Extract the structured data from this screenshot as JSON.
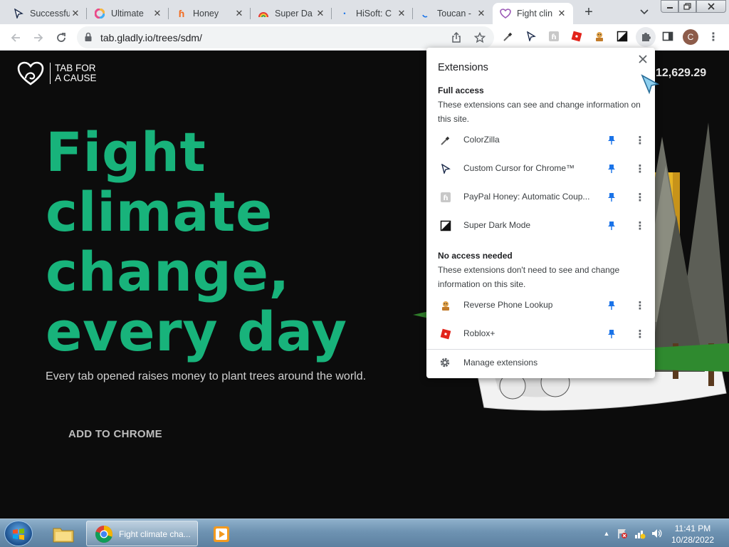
{
  "tabs": [
    {
      "label": "Successfu",
      "icon": "cursor-icon"
    },
    {
      "label": "Ultimate",
      "icon": "colorful-circle-icon"
    },
    {
      "label": "Honey",
      "icon": "honey-icon"
    },
    {
      "label": "Super Da",
      "icon": "rainbow-icon"
    },
    {
      "label": "HiSoft: C",
      "icon": "loading-icon"
    },
    {
      "label": "Toucan -",
      "icon": "loading-icon"
    },
    {
      "label": "Fight clin",
      "icon": "tab-for-a-cause-icon"
    }
  ],
  "address_bar": {
    "url": "tab.gladly.io/trees/sdm/"
  },
  "profile": {
    "initial": "C"
  },
  "page": {
    "logo_line1": "TAB FOR",
    "logo_line2": "A CAUSE",
    "counter": "12,629.29",
    "headline_1": "Fight",
    "headline_2": "climate",
    "headline_3": "change,",
    "headline_4": "every day",
    "subline": "Every tab opened raises money to plant trees around the world.",
    "cta": "ADD TO CHROME"
  },
  "extensions_popup": {
    "title": "Extensions",
    "full_access": {
      "heading": "Full access",
      "description": "These extensions can see and change information on this site.",
      "items": [
        {
          "name": "ColorZilla",
          "icon": "eyedropper-icon"
        },
        {
          "name": "Custom Cursor for Chrome™",
          "icon": "cursor-icon"
        },
        {
          "name": "PayPal Honey: Automatic Coup...",
          "icon": "honey-icon"
        },
        {
          "name": "Super Dark Mode",
          "icon": "dark-mode-icon"
        }
      ]
    },
    "no_access": {
      "heading": "No access needed",
      "description": "These extensions don't need to see and change information on this site.",
      "items": [
        {
          "name": "Reverse Phone Lookup",
          "icon": "phone-lookup-icon"
        },
        {
          "name": "Roblox+",
          "icon": "roblox-icon"
        }
      ]
    },
    "manage_label": "Manage extensions"
  },
  "taskbar": {
    "chrome_label": "Fight climate cha...",
    "time": "11:41 PM",
    "date": "10/28/2022"
  },
  "colors": {
    "headline_green": "#18b37b",
    "pin_blue": "#1a73e8",
    "page_bg": "#0c0c0c"
  }
}
